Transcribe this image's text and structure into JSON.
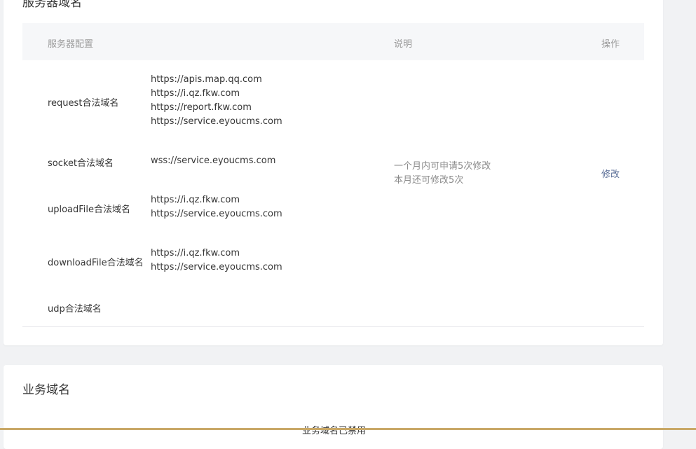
{
  "server_section": {
    "title": "服务器域名",
    "headers": {
      "config": "服务器配置",
      "desc": "说明",
      "action": "操作"
    },
    "rows": [
      {
        "label": "request合法域名",
        "values": [
          "https://apis.map.qq.com",
          "https://i.qz.fkw.com",
          "https://report.fkw.com",
          "https://service.eyoucms.com"
        ]
      },
      {
        "label": "socket合法域名",
        "values": [
          "wss://service.eyoucms.com"
        ]
      },
      {
        "label": "uploadFile合法域名",
        "values": [
          "https://i.qz.fkw.com",
          "https://service.eyoucms.com"
        ]
      },
      {
        "label": "downloadFile合法域名",
        "values": [
          "https://i.qz.fkw.com",
          "https://service.eyoucms.com"
        ]
      },
      {
        "label": "udp合法域名",
        "values": []
      }
    ],
    "desc_line1": "一个月内可申请5次修改",
    "desc_line2": "本月还可修改5次",
    "action_label": "修改"
  },
  "biz_section": {
    "title": "业务域名",
    "status": "业务域名已禁用"
  },
  "colors": {
    "link": "#576b95",
    "header_bg": "#f6f7f9",
    "page_bg": "#f1f2f4"
  }
}
